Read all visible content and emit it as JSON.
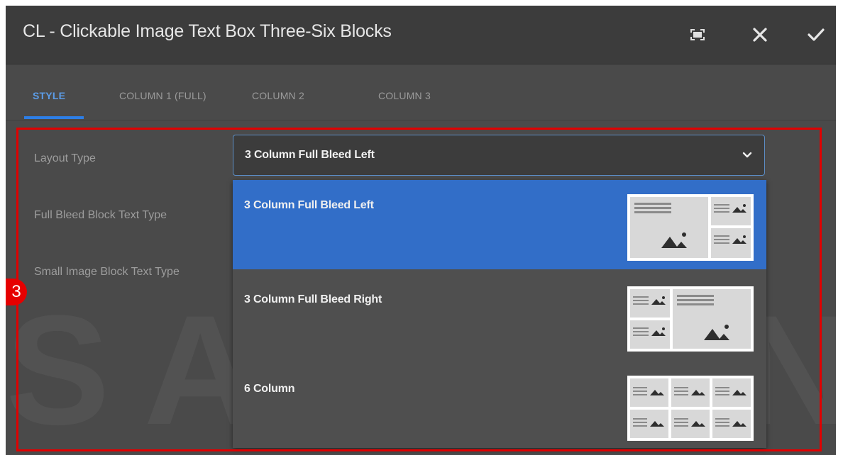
{
  "dialog": {
    "title": "CL - Clickable Image Text Box Three-Six Blocks",
    "toolbar": {
      "fullscreen_icon": "fullscreen-icon",
      "close_icon": "close-icon",
      "done_icon": "check-icon"
    }
  },
  "tabs": [
    {
      "label": "STYLE",
      "active": true
    },
    {
      "label": "COLUMN 1 (FULL)",
      "active": false
    },
    {
      "label": "COLUMN 2",
      "active": false
    },
    {
      "label": "COLUMN 3",
      "active": false
    }
  ],
  "fields": {
    "layout_type": {
      "label": "Layout Type",
      "value": "3 Column Full Bleed Left",
      "options": [
        {
          "label": "3 Column Full Bleed Left",
          "selected": true
        },
        {
          "label": "3 Column Full Bleed Right",
          "selected": false
        },
        {
          "label": "6 Column",
          "selected": false
        }
      ]
    },
    "full_bleed_block_text_type": {
      "label": "Full Bleed Block Text Type"
    },
    "small_image_block_text_type": {
      "label": "Small Image Block Text Type"
    }
  },
  "watermark": "SAMSUNG",
  "annotation_badge": "3",
  "colors": {
    "accent": "#2d7ee6",
    "selected_option": "#326ec8",
    "highlight_box": "#e00000",
    "dialog_bg": "#4a4a4a"
  }
}
